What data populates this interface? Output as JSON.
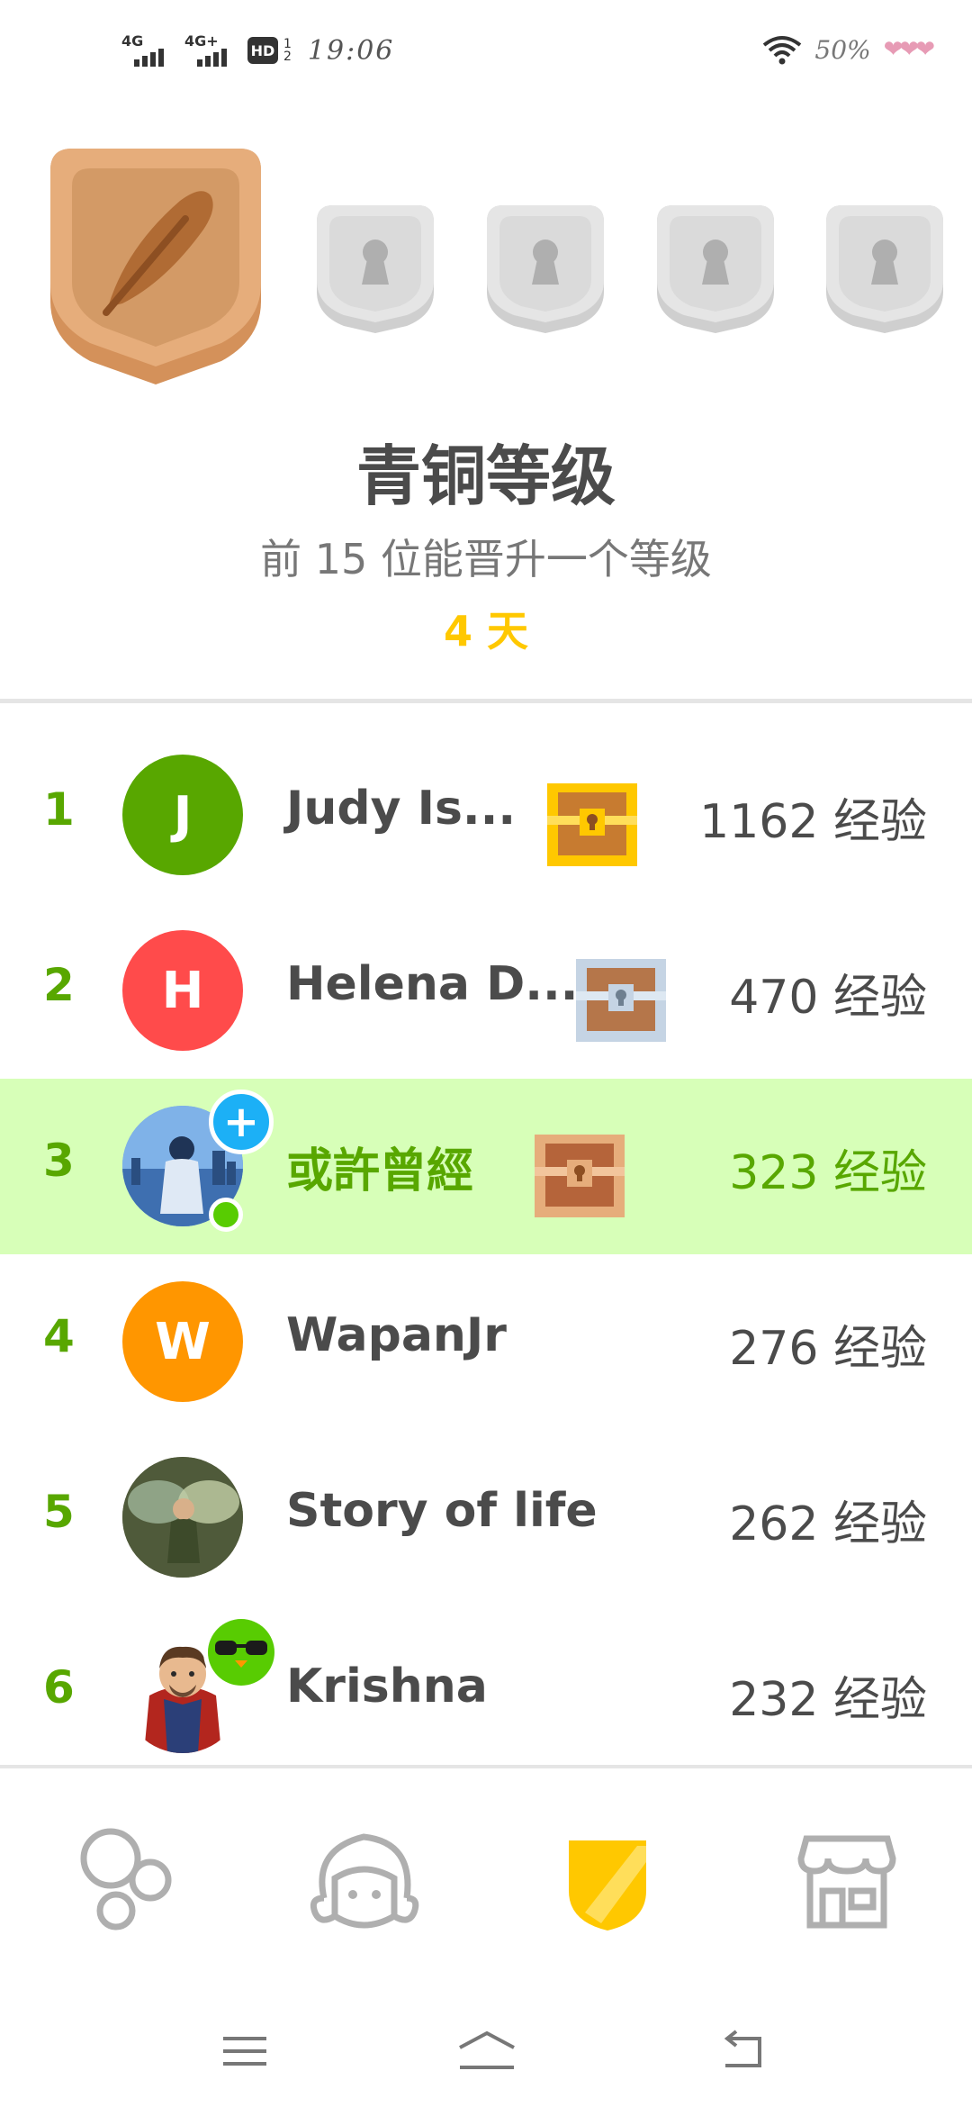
{
  "status_bar": {
    "net1": "4G",
    "net2": "4G+",
    "hd": "HD",
    "sim": "1\n2",
    "time": "19:06",
    "battery": "50%",
    "hearts": "❤❤❤"
  },
  "league": {
    "title": "青铜等级",
    "subtitle": "前 15 位能晋升一个等级",
    "days": "4 天",
    "badges": [
      "bronze-feather-badge",
      "locked-badge",
      "locked-badge",
      "locked-badge",
      "locked-badge"
    ]
  },
  "leaderboard": [
    {
      "rank": "1",
      "initial": "J",
      "name": "Judy Is...",
      "chest": "gold",
      "xp": "1162 经验",
      "avatar_color": "#58a700"
    },
    {
      "rank": "2",
      "initial": "H",
      "name": "Helena D...",
      "chest": "silver",
      "xp": "470 经验",
      "avatar_color": "#ff4b4b"
    },
    {
      "rank": "3",
      "initial": "",
      "name": "或許曾經",
      "chest": "bronze",
      "xp": "323 经验",
      "avatar_color": "#5b8fd6"
    },
    {
      "rank": "4",
      "initial": "W",
      "name": "WapanJr",
      "chest": "",
      "xp": "276 经验",
      "avatar_color": "#ff9600"
    },
    {
      "rank": "5",
      "initial": "",
      "name": "Story of life",
      "chest": "",
      "xp": "262 经验",
      "avatar_color": "#6b6a4a"
    },
    {
      "rank": "6",
      "initial": "",
      "name": "Krishna",
      "chest": "",
      "xp": "232 经验",
      "avatar_color": "#ffffff"
    }
  ],
  "tabs": [
    {
      "name": "learn-tab",
      "icon": "bubbles-icon"
    },
    {
      "name": "profile-tab",
      "icon": "face-icon"
    },
    {
      "name": "leaderboard-tab",
      "icon": "shield-icon"
    },
    {
      "name": "shop-tab",
      "icon": "shop-icon"
    }
  ],
  "colors": {
    "accent_green": "#58a700",
    "highlight_bg": "#d7ffb8",
    "gold": "#ffc800",
    "bronze": "#e2a672"
  }
}
